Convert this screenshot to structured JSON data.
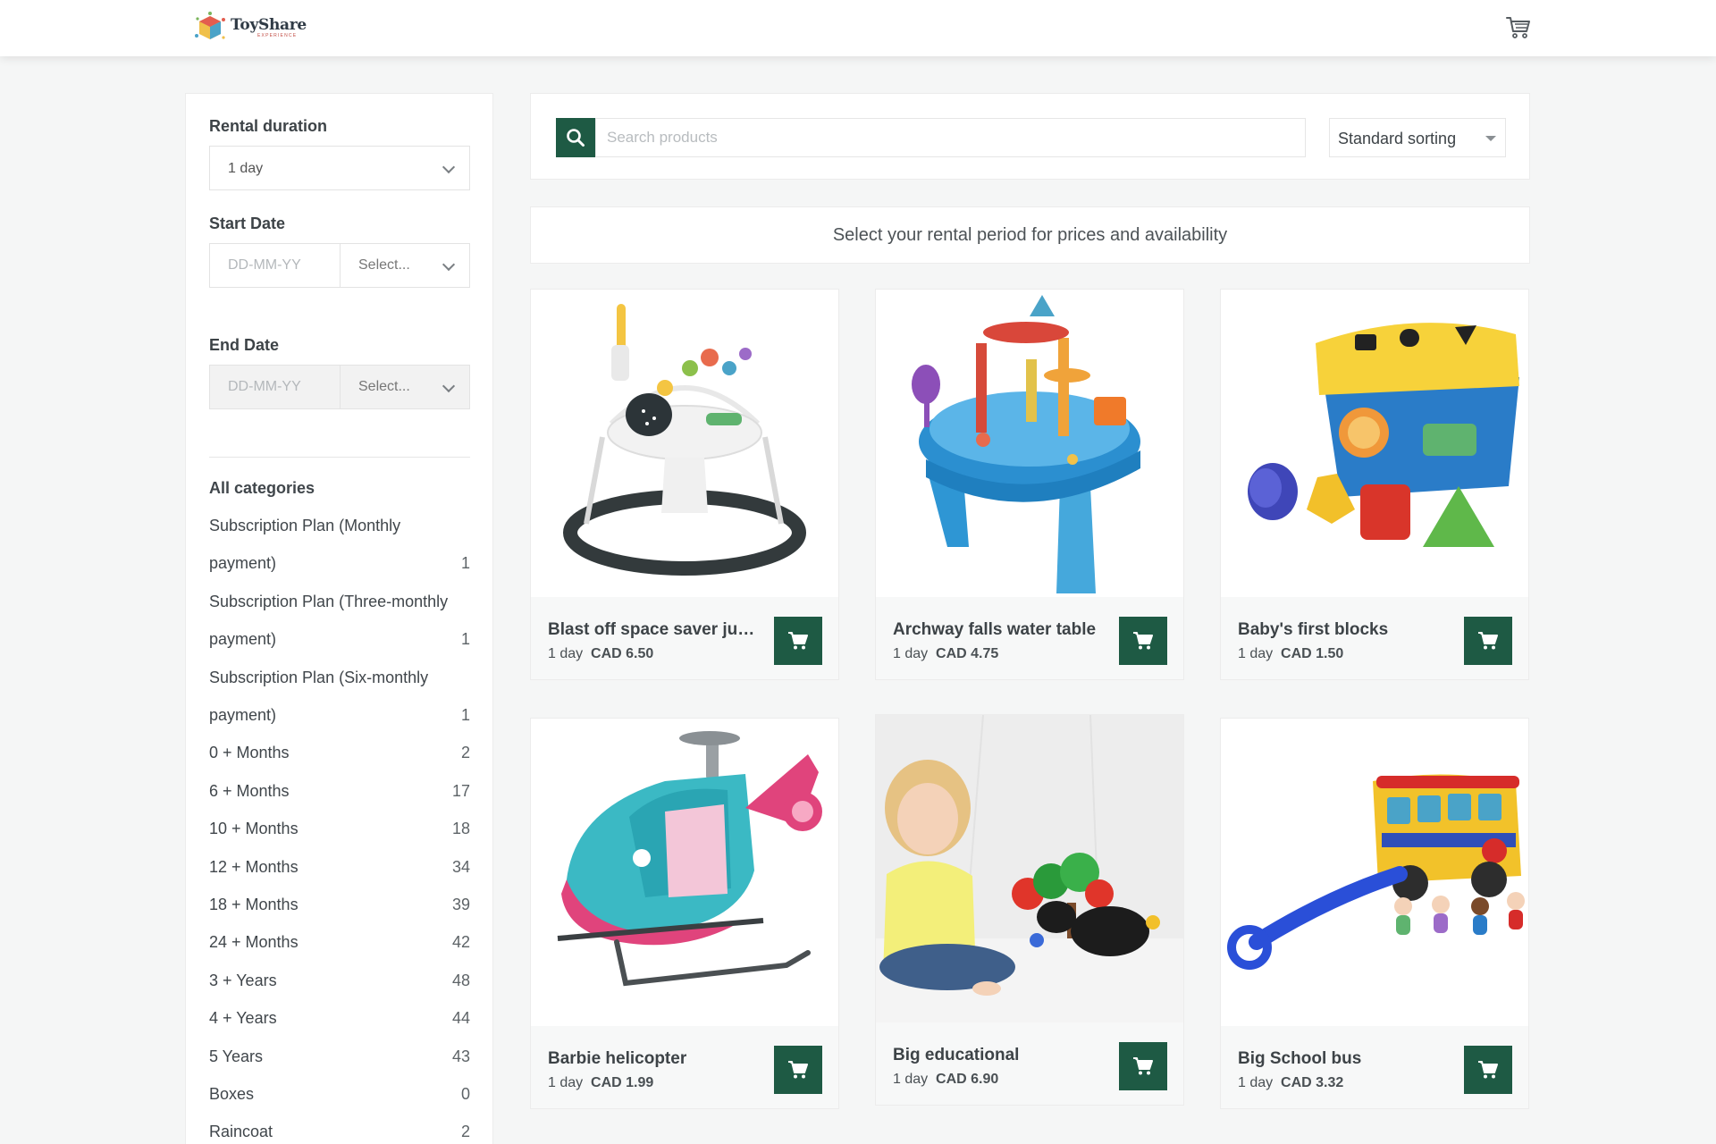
{
  "header": {
    "logo_name": "ToyShare",
    "logo_sub": "EXPERIENCE",
    "cart_icon": "cart-icon"
  },
  "sidebar": {
    "rental_duration": {
      "label": "Rental duration",
      "value": "1 day"
    },
    "start_date": {
      "label": "Start Date",
      "placeholder": "DD-MM-YY",
      "select": "Select..."
    },
    "end_date": {
      "label": "End Date",
      "placeholder": "DD-MM-YY",
      "select": "Select..."
    },
    "categories": [
      {
        "label": "All categories",
        "count": ""
      },
      {
        "label": "Subscription Plan (Monthly",
        "count": ""
      },
      {
        "label": "payment)",
        "count": "1"
      },
      {
        "label": "Subscription Plan (Three-monthly",
        "count": ""
      },
      {
        "label": "payment)",
        "count": "1"
      },
      {
        "label": "Subscription Plan (Six-monthly",
        "count": ""
      },
      {
        "label": "payment)",
        "count": "1"
      },
      {
        "label": "0 + Months",
        "count": "2"
      },
      {
        "label": "6 + Months",
        "count": "17"
      },
      {
        "label": "10 + Months",
        "count": "18"
      },
      {
        "label": "12 + Months",
        "count": "34"
      },
      {
        "label": "18 + Months",
        "count": "39"
      },
      {
        "label": "24 + Months",
        "count": "42"
      },
      {
        "label": "3 + Years",
        "count": "48"
      },
      {
        "label": "4 + Years",
        "count": "44"
      },
      {
        "label": "5 Years",
        "count": "43"
      },
      {
        "label": "Boxes",
        "count": "0"
      },
      {
        "label": "Raincoat",
        "count": "2"
      }
    ]
  },
  "search": {
    "placeholder": "Search products",
    "sort_value": "Standard sorting"
  },
  "notice": "Select your rental period for prices and availability",
  "products": [
    {
      "name": "Blast off space saver jum...",
      "duration": "1 day",
      "price": "CAD 6.50"
    },
    {
      "name": "Archway falls water table",
      "duration": "1 day",
      "price": "CAD 4.75"
    },
    {
      "name": "Baby's first blocks",
      "duration": "1 day",
      "price": "CAD 1.50"
    },
    {
      "name": "Barbie helicopter",
      "duration": "1 day",
      "price": "CAD 1.99"
    },
    {
      "name": "Big educational",
      "duration": "1 day",
      "price": "CAD 6.90"
    },
    {
      "name": "Big School bus",
      "duration": "1 day",
      "price": "CAD 3.32"
    }
  ],
  "colors": {
    "accent": "#1e5a44",
    "background": "#f5f6f6"
  }
}
